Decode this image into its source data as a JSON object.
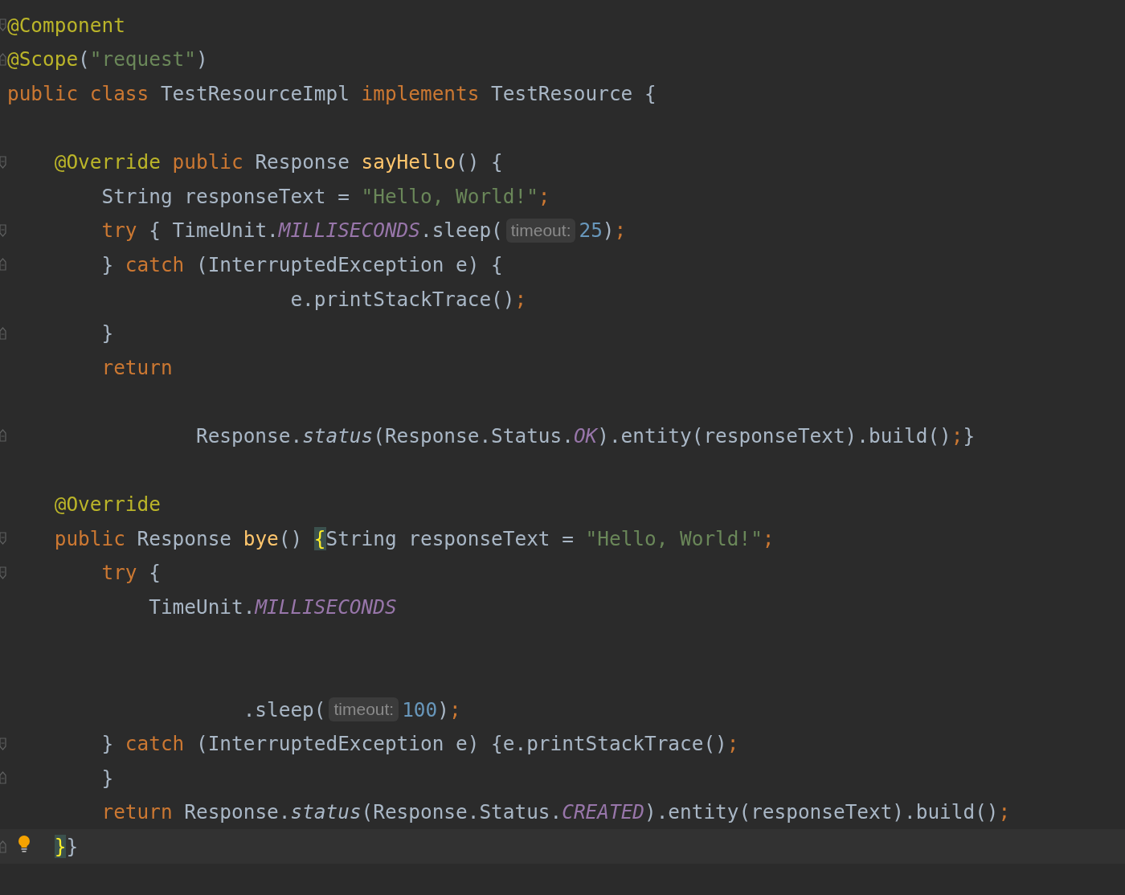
{
  "editor": {
    "lines": [
      {
        "kind": "code",
        "fold_start": true,
        "tokens": [
          {
            "kind": "annotation",
            "text": "@Component"
          }
        ]
      },
      {
        "kind": "code",
        "fold_end": true,
        "tokens": [
          {
            "kind": "annotation",
            "text": "@Scope"
          },
          {
            "kind": "plain",
            "text": "("
          },
          {
            "kind": "string",
            "text": "\"request\""
          },
          {
            "kind": "plain",
            "text": ")"
          }
        ]
      },
      {
        "kind": "code",
        "tokens": [
          {
            "kind": "keyword",
            "text": "public class "
          },
          {
            "kind": "plain",
            "text": "TestResourceImpl "
          },
          {
            "kind": "keyword",
            "text": "implements "
          },
          {
            "kind": "plain",
            "text": "TestResource {"
          }
        ]
      },
      {
        "kind": "blank"
      },
      {
        "kind": "code",
        "fold_start": true,
        "tokens": [
          {
            "kind": "annotation",
            "text": "    @Override "
          },
          {
            "kind": "keyword",
            "text": "public "
          },
          {
            "kind": "plain",
            "text": "Response "
          },
          {
            "kind": "method",
            "text": "sayHello"
          },
          {
            "kind": "plain",
            "text": "() {"
          }
        ]
      },
      {
        "kind": "code",
        "tokens": [
          {
            "kind": "plain",
            "text": "        String responseText = "
          },
          {
            "kind": "string",
            "text": "\"Hello, World!\""
          },
          {
            "kind": "keyword",
            "text": ";"
          }
        ]
      },
      {
        "kind": "code",
        "fold_start": true,
        "tokens": [
          {
            "kind": "keyword",
            "text": "        try "
          },
          {
            "kind": "plain",
            "text": "{ TimeUnit."
          },
          {
            "kind": "field",
            "text": "MILLISECONDS"
          },
          {
            "kind": "plain",
            "text": ".sleep("
          },
          {
            "kind": "hint",
            "text": "timeout:"
          },
          {
            "kind": "number",
            "text": "25"
          },
          {
            "kind": "plain",
            "text": ")"
          },
          {
            "kind": "keyword",
            "text": ";"
          }
        ]
      },
      {
        "kind": "code",
        "fold_end": true,
        "tokens": [
          {
            "kind": "plain",
            "text": "        } "
          },
          {
            "kind": "keyword",
            "text": "catch "
          },
          {
            "kind": "plain",
            "text": "(InterruptedException e) {"
          }
        ]
      },
      {
        "kind": "code",
        "tokens": [
          {
            "kind": "plain",
            "text": "                        e.printStackTrace()"
          },
          {
            "kind": "keyword",
            "text": ";"
          }
        ]
      },
      {
        "kind": "code",
        "fold_end": true,
        "tokens": [
          {
            "kind": "plain",
            "text": "        }"
          }
        ]
      },
      {
        "kind": "code",
        "tokens": [
          {
            "kind": "keyword",
            "text": "        return"
          }
        ]
      },
      {
        "kind": "blank"
      },
      {
        "kind": "code",
        "fold_end": true,
        "tokens": [
          {
            "kind": "plain",
            "text": "                Response."
          },
          {
            "kind": "static",
            "text": "status"
          },
          {
            "kind": "plain",
            "text": "(Response.Status."
          },
          {
            "kind": "field",
            "text": "OK"
          },
          {
            "kind": "plain",
            "text": ").entity(responseText).build()"
          },
          {
            "kind": "keyword",
            "text": ";"
          },
          {
            "kind": "plain",
            "text": "}"
          }
        ]
      },
      {
        "kind": "blank"
      },
      {
        "kind": "code",
        "tokens": [
          {
            "kind": "annotation",
            "text": "    @Override"
          }
        ]
      },
      {
        "kind": "code",
        "fold_start": true,
        "tokens": [
          {
            "kind": "keyword",
            "text": "    public "
          },
          {
            "kind": "plain",
            "text": "Response "
          },
          {
            "kind": "method",
            "text": "bye"
          },
          {
            "kind": "plain",
            "text": "() "
          },
          {
            "kind": "brace_match",
            "text": "{"
          },
          {
            "kind": "plain",
            "text": "String responseText = "
          },
          {
            "kind": "string",
            "text": "\"Hello, World!\""
          },
          {
            "kind": "keyword",
            "text": ";"
          }
        ]
      },
      {
        "kind": "code",
        "fold_start": true,
        "tokens": [
          {
            "kind": "keyword",
            "text": "        try "
          },
          {
            "kind": "plain",
            "text": "{"
          }
        ]
      },
      {
        "kind": "code",
        "tokens": [
          {
            "kind": "plain",
            "text": "            TimeUnit."
          },
          {
            "kind": "field",
            "text": "MILLISECONDS"
          }
        ]
      },
      {
        "kind": "blank"
      },
      {
        "kind": "blank"
      },
      {
        "kind": "code",
        "tokens": [
          {
            "kind": "plain",
            "text": "                    .sleep("
          },
          {
            "kind": "hint",
            "text": "timeout:"
          },
          {
            "kind": "number",
            "text": "100"
          },
          {
            "kind": "plain",
            "text": ")"
          },
          {
            "kind": "keyword",
            "text": ";"
          }
        ]
      },
      {
        "kind": "code",
        "fold_start": true,
        "tokens": [
          {
            "kind": "plain",
            "text": "        } "
          },
          {
            "kind": "keyword",
            "text": "catch "
          },
          {
            "kind": "plain",
            "text": "(InterruptedException e) {e.printStackTrace()"
          },
          {
            "kind": "keyword",
            "text": ";"
          }
        ]
      },
      {
        "kind": "code",
        "fold_end": true,
        "tokens": [
          {
            "kind": "plain",
            "text": "        }"
          }
        ]
      },
      {
        "kind": "code",
        "tokens": [
          {
            "kind": "keyword",
            "text": "        return "
          },
          {
            "kind": "plain",
            "text": "Response."
          },
          {
            "kind": "static",
            "text": "status"
          },
          {
            "kind": "plain",
            "text": "(Response.Status."
          },
          {
            "kind": "field",
            "text": "CREATED"
          },
          {
            "kind": "plain",
            "text": ").entity(responseText).build()"
          },
          {
            "kind": "keyword",
            "text": ";"
          }
        ]
      },
      {
        "kind": "code",
        "fold_end": true,
        "current": true,
        "bulb": true,
        "tokens": [
          {
            "kind": "indent_brace_match",
            "text": "    }"
          },
          {
            "kind": "plain",
            "text": "}"
          }
        ]
      }
    ]
  }
}
